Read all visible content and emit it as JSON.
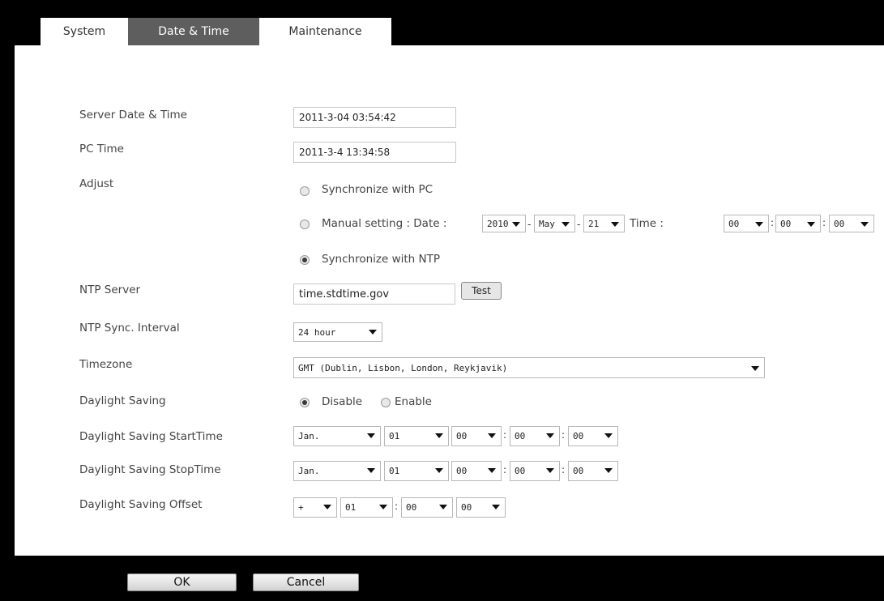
{
  "tabs": [
    "System",
    "Date & Time",
    "Maintenance"
  ],
  "labels": {
    "server_datetime": "Server Date & Time",
    "pc_time": "PC Time",
    "adjust": "Adjust",
    "ntp_server": "NTP Server",
    "ntp_interval": "NTP Sync. Interval",
    "timezone": "Timezone",
    "daylight_saving": "Daylight Saving",
    "ds_start": "Daylight Saving StartTime",
    "ds_stop": "Daylight Saving StopTime",
    "ds_offset": "Daylight Saving Offset"
  },
  "values": {
    "server_datetime": "2011-3-04 03:54:42",
    "pc_time": "2011-3-4 13:34:58",
    "ntp_server": "time.stdtime.gov"
  },
  "adjust": {
    "sync_pc": "Synchronize with PC",
    "manual_date": "Manual setting : Date :",
    "time_label": "Time :",
    "sync_ntp": "Synchronize with NTP",
    "selected": "sync_ntp",
    "manual": {
      "year": "2010",
      "month": "May",
      "day": "21",
      "hour": "00",
      "minute": "00",
      "second": "00",
      "date_sep": "-",
      "time_sep": ":"
    }
  },
  "test_button": "Test",
  "ntp_interval": "24 hour",
  "timezone": "GMT (Dublin, Lisbon, London, Reykjavik)",
  "daylight": {
    "disable": "Disable",
    "enable": "Enable",
    "selected": "disable",
    "start": {
      "month": "Jan.",
      "day": "01",
      "hour": "00",
      "minute": "00",
      "second": "00"
    },
    "stop": {
      "month": "Jan.",
      "day": "01",
      "hour": "00",
      "minute": "00",
      "second": "00"
    },
    "offset": {
      "sign": "+",
      "hour": "01",
      "minute": "00",
      "second": "00"
    },
    "sep": ":"
  },
  "buttons": {
    "ok": "OK",
    "cancel": "Cancel"
  },
  "colors": {
    "tab_active": "#5e5e5e",
    "frame": "#000000"
  }
}
